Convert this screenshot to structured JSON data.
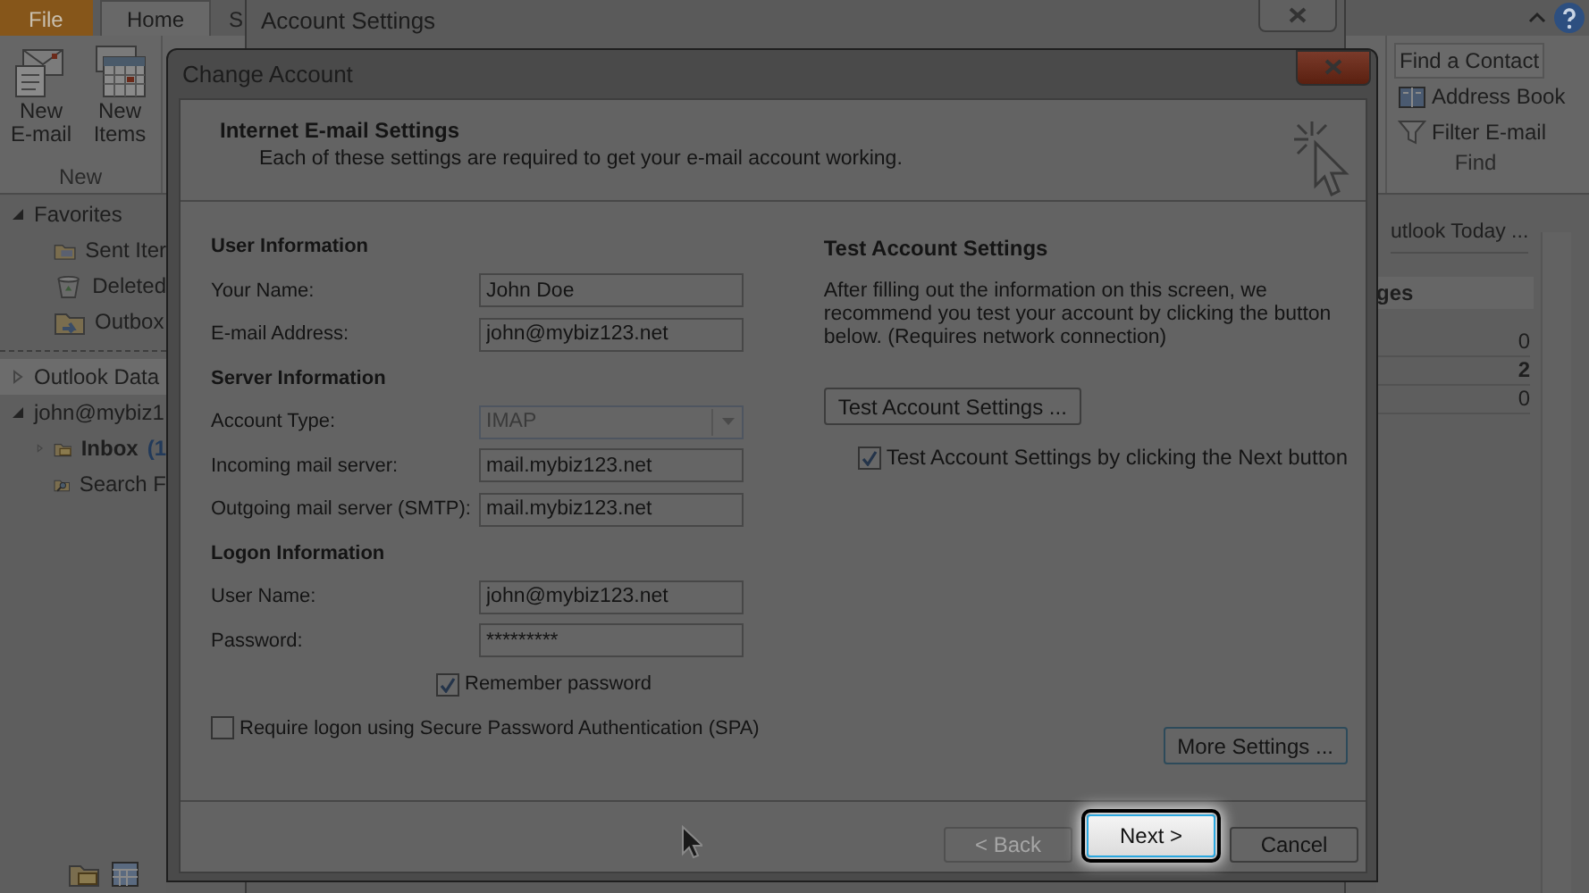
{
  "ribbon": {
    "tabs": [
      {
        "label": "File",
        "kind": "file",
        "selected": false
      },
      {
        "label": "Home",
        "kind": "tab",
        "selected": true
      },
      {
        "label": "S",
        "kind": "tab",
        "selected": false
      }
    ],
    "new_group": {
      "buttons": [
        {
          "label": "New E-mail",
          "kind": "email"
        },
        {
          "label": "New Items",
          "kind": "items"
        }
      ],
      "label": "New"
    },
    "find_group": {
      "buttons": [
        {
          "label": "Find a Contact",
          "kind": "contact"
        },
        {
          "label": "Address Book",
          "kind": "book"
        },
        {
          "label": "Filter E-mail",
          "kind": "filter"
        }
      ],
      "label": "Find"
    }
  },
  "nav": [
    {
      "label": "Favorites",
      "expanded": true,
      "selected": false,
      "children": [
        {
          "label": "Sent Iter",
          "kind": "sent"
        },
        {
          "label": "Deleted",
          "kind": "deleted"
        },
        {
          "label": "Outbox",
          "kind": "outbox"
        }
      ]
    },
    {
      "label": "Outlook Data",
      "expanded": false,
      "selected": true
    },
    {
      "label": "john@mybiz1",
      "expanded": true,
      "selected": false,
      "children": [
        {
          "label": "Inbox",
          "count": "(1",
          "kind": "inbox"
        },
        {
          "label": "Search F",
          "kind": "search"
        }
      ]
    }
  ],
  "right_pane": {
    "link": "utlook Today ...",
    "header": "ges",
    "counts": [
      {
        "value": "0",
        "bold": false
      },
      {
        "value": "2",
        "bold": true
      },
      {
        "value": "0",
        "bold": false
      }
    ]
  },
  "account_settings": {
    "title": "Account Settings"
  },
  "dialog": {
    "title": "Change Account",
    "heading": "Internet E-mail Settings",
    "subheading": "Each of these settings are required to get your e-mail account working.",
    "form": [
      {
        "kind": "heading",
        "text": "User Information"
      },
      {
        "kind": "field",
        "label": "Your Name:",
        "value": "John Doe"
      },
      {
        "kind": "field",
        "label": "E-mail Address:",
        "value": "john@mybiz123.net"
      },
      {
        "kind": "heading",
        "text": "Server Information"
      },
      {
        "kind": "dropdown",
        "label": "Account Type:",
        "value": "IMAP",
        "disabled": true
      },
      {
        "kind": "field",
        "label": "Incoming mail server:",
        "value": "mail.mybiz123.net"
      },
      {
        "kind": "field",
        "label": "Outgoing mail server (SMTP):",
        "value": "mail.mybiz123.net"
      },
      {
        "kind": "heading",
        "text": "Logon Information"
      },
      {
        "kind": "field",
        "label": "User Name:",
        "value": "john@mybiz123.net"
      },
      {
        "kind": "field",
        "label": "Password:",
        "value": "*********"
      },
      {
        "kind": "field_check",
        "label": "Remember password",
        "checked": true
      },
      {
        "kind": "check",
        "label": "Require logon using Secure Password Authentication (SPA)",
        "checked": false
      }
    ],
    "test": {
      "heading": "Test Account Settings",
      "text": "After filling out the information on this screen, we recommend you test your account by clicking the button below. (Requires network connection)",
      "button": "Test Account Settings ...",
      "check": {
        "label": "Test Account Settings by clicking the Next button",
        "checked": true
      }
    },
    "more_settings": "More Settings ...",
    "footer": [
      {
        "label": "< Back",
        "disabled": true,
        "highlighted": false
      },
      {
        "label": "Next >",
        "disabled": false,
        "highlighted": true
      },
      {
        "label": "Cancel",
        "disabled": false,
        "highlighted": false
      }
    ]
  }
}
